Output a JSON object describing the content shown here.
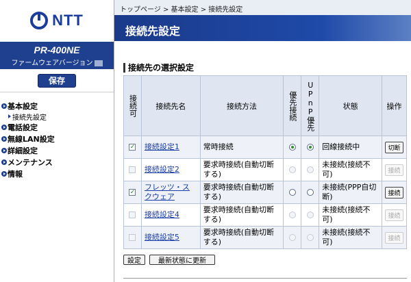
{
  "brand": {
    "logo_text": "NTT",
    "model": "PR-400NE",
    "firmware_label": "ファームウェアバージョン"
  },
  "left": {
    "save_label": "保存",
    "nav": [
      {
        "label": "基本設定",
        "sub": [
          "接続先設定"
        ]
      },
      {
        "label": "電話設定"
      },
      {
        "label": "無線LAN設定"
      },
      {
        "label": "詳細設定"
      },
      {
        "label": "メンテナンス"
      },
      {
        "label": "情報"
      }
    ]
  },
  "breadcrumb": "トップページ > 基本設定 > 接続先設定",
  "page_title": "接続先設定",
  "section_title": "接続先の選択設定",
  "table": {
    "headers": [
      "接続可",
      "接続先名",
      "接続方法",
      "優先接続",
      "UPnP優先",
      "状態",
      "操作"
    ],
    "rows": [
      {
        "enabled": true,
        "name": "接続設定1",
        "method": "常時接続",
        "priority": "on",
        "upnp": "on",
        "status": "回線接続中",
        "action": "切断",
        "action_enabled": true
      },
      {
        "enabled": false,
        "name": "接続設定2",
        "method": "要求時接続(自動切断する)",
        "priority": "dis",
        "upnp": "dis",
        "status": "未接続(接続不可)",
        "action": "接続",
        "action_enabled": false
      },
      {
        "enabled": true,
        "name": "フレッツ・スクウェア",
        "method": "要求時接続(自動切断する)",
        "priority": "off",
        "upnp": "off",
        "status": "未接続(PPP自切断)",
        "action": "接続",
        "action_enabled": true
      },
      {
        "enabled": false,
        "name": "接続設定4",
        "method": "要求時接続(自動切断する)",
        "priority": "dis",
        "upnp": "dis",
        "status": "未接続(接続不可)",
        "action": "接続",
        "action_enabled": false
      },
      {
        "enabled": false,
        "name": "接続設定5",
        "method": "要求時接続(自動切断する)",
        "priority": "dis",
        "upnp": "dis",
        "status": "未接続(接続不可)",
        "action": "接続",
        "action_enabled": false
      }
    ]
  },
  "buttons": {
    "set": "設定",
    "refresh": "最新状態に更新"
  },
  "colors": {
    "navy": "#1f3f8f",
    "title_bar": "#1a3a8a",
    "header_bg": "#dfe6f1"
  }
}
